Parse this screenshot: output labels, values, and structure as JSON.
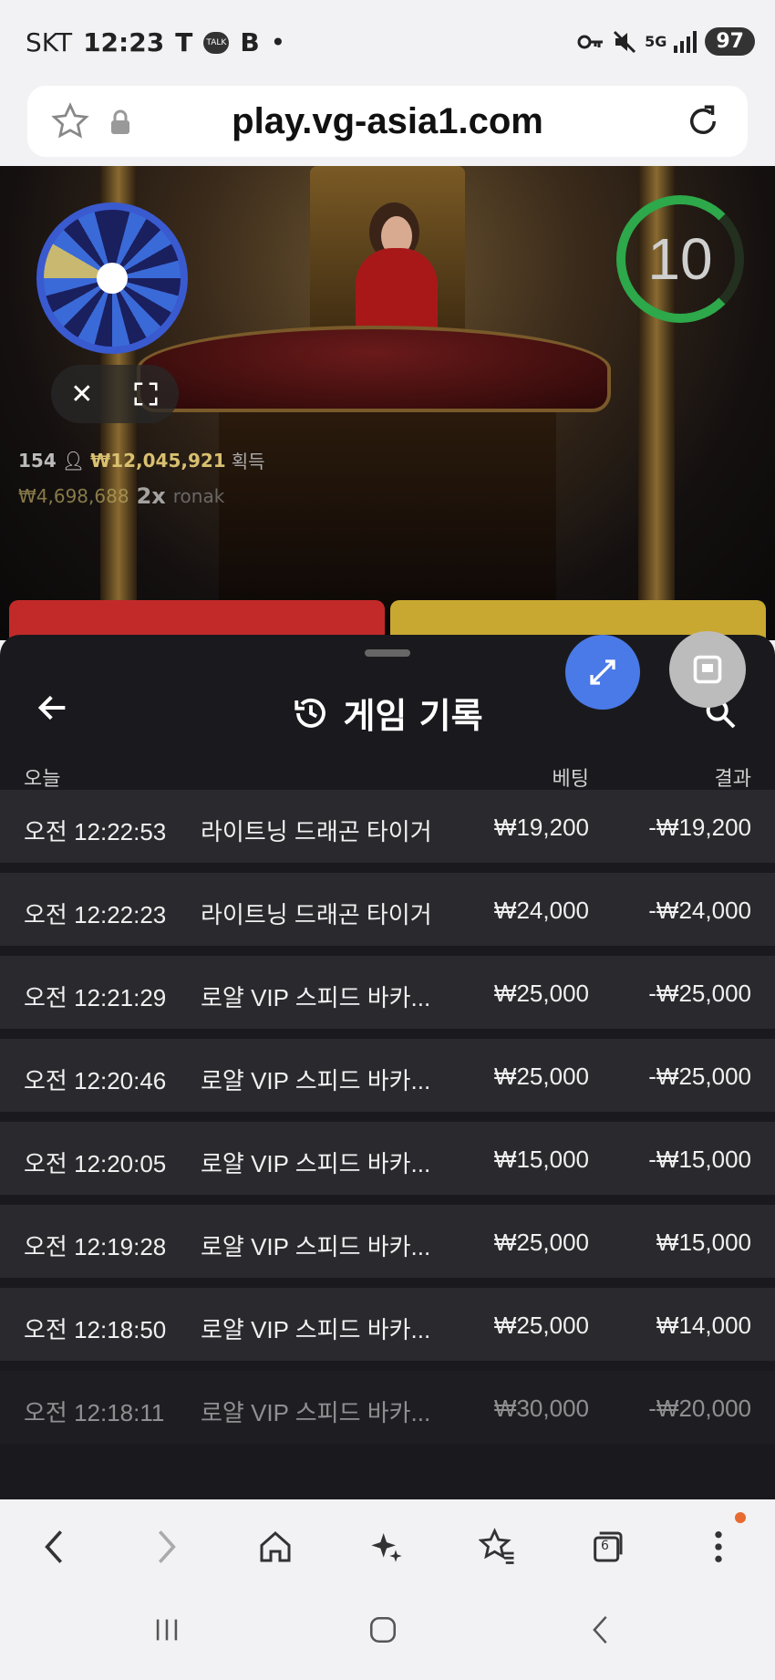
{
  "status_bar": {
    "carrier": "SKT",
    "time": "12:23",
    "battery": "97",
    "network": "5G"
  },
  "browser": {
    "url": "play.vg-asia1.com",
    "tab_count": "6"
  },
  "video": {
    "timer": "10",
    "player_count": "154",
    "total_won": "₩12,045,921",
    "won_label": "획득",
    "top_win_amount": "₩4,698,688",
    "top_win_multiplier": "2x",
    "top_win_user": "ronak"
  },
  "history_panel": {
    "title": "게임 기록",
    "columns": {
      "date": "오늘",
      "bet": "베팅",
      "result": "결과"
    },
    "rows": [
      {
        "time": "오전 12:22:53",
        "game": "라이트닝 드래곤 타이거",
        "bet": "₩19,200",
        "result": "-₩19,200"
      },
      {
        "time": "오전 12:22:23",
        "game": "라이트닝 드래곤 타이거",
        "bet": "₩24,000",
        "result": "-₩24,000"
      },
      {
        "time": "오전 12:21:29",
        "game": "로얄 VIP 스피드 바카...",
        "bet": "₩25,000",
        "result": "-₩25,000"
      },
      {
        "time": "오전 12:20:46",
        "game": "로얄 VIP 스피드 바카...",
        "bet": "₩25,000",
        "result": "-₩25,000"
      },
      {
        "time": "오전 12:20:05",
        "game": "로얄 VIP 스피드 바카...",
        "bet": "₩15,000",
        "result": "-₩15,000"
      },
      {
        "time": "오전 12:19:28",
        "game": "로얄 VIP 스피드 바카...",
        "bet": "₩25,000",
        "result": "₩15,000"
      },
      {
        "time": "오전 12:18:50",
        "game": "로얄 VIP 스피드 바카...",
        "bet": "₩25,000",
        "result": "₩14,000"
      },
      {
        "time": "오전 12:18:11",
        "game": "로얄 VIP 스피드 바카...",
        "bet": "₩30,000",
        "result": "-₩20,000"
      }
    ]
  },
  "colors": {
    "fab_blue": "#4a7ae8",
    "timer_green": "#2da84a",
    "sheet_bg": "#1a1a1e",
    "row_bg": "#2a2a2e"
  }
}
